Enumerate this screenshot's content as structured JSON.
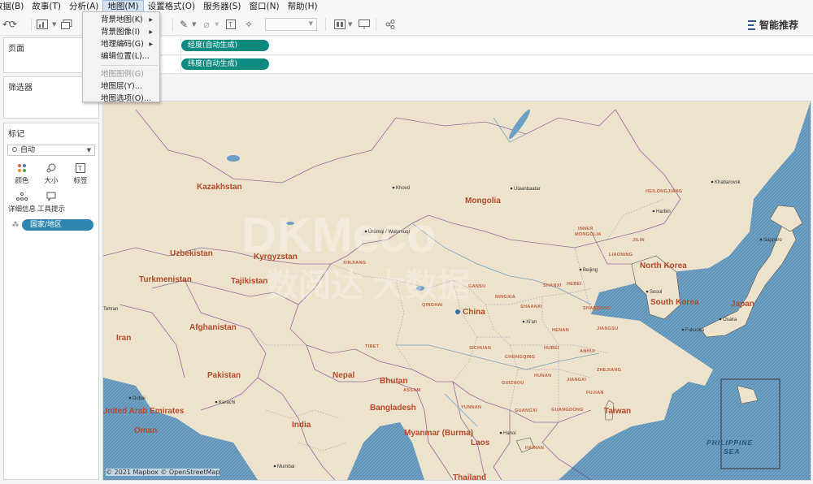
{
  "menu": [
    "数据(B)",
    "故事(T)",
    "分析(A)",
    "地图(M)",
    "设置格式(O)",
    "服务器(S)",
    "窗口(N)",
    "帮助(H)"
  ],
  "toolbar": {
    "smart_label": "智能推荐"
  },
  "map_menu": {
    "items": [
      {
        "label": "背景地图(K)",
        "submenu": true,
        "disabled": false
      },
      {
        "label": "背景图像(I)",
        "submenu": true,
        "disabled": false
      },
      {
        "label": "地理编码(G)",
        "submenu": true,
        "disabled": false
      },
      {
        "label": "编辑位置(L)...",
        "submenu": false,
        "disabled": false
      },
      {
        "label": "地图图例(G)",
        "submenu": false,
        "disabled": true
      },
      {
        "label": "地图层(Y)...",
        "submenu": false,
        "disabled": false
      },
      {
        "label": "地图选项(O)...",
        "submenu": false,
        "disabled": false
      }
    ]
  },
  "panels": {
    "pages": "页面",
    "filters": "筛选器",
    "marks": "标记"
  },
  "marks": {
    "type": "自动",
    "buttons": {
      "color": "颜色",
      "size": "大小",
      "label": "标签",
      "detail": "详细信息",
      "tooltip": "工具提示"
    },
    "pill": "国家/地区"
  },
  "shelves": {
    "columns_pill": "经度(自动生成)",
    "rows_pill": "纬度(自动生成)"
  },
  "map": {
    "attribution": "© 2021 Mapbox © OpenStreetMap",
    "countries": [
      "Kazakhstan",
      "Mongolia",
      "Uzbekistan",
      "Kyrgyzstan",
      "Turkmenistan",
      "Tajikistan",
      "Afghanistan",
      "Iran",
      "Pakistan",
      "Nepal",
      "Bhutan",
      "Bangladesh",
      "India",
      "Myanmar (Burma)",
      "Laos",
      "Thailand",
      "China",
      "North Korea",
      "South Korea",
      "Japan",
      "Taiwan",
      "Oman",
      "United Arab Emirates"
    ],
    "seas": [
      "PHILIPPINE",
      "SEA"
    ],
    "regions": [
      "HEILONGJIANG",
      "JILIN",
      "LIAONING",
      "INNER",
      "MONGOLIA",
      "XINJIANG",
      "QINGHAI",
      "GANSU",
      "NINGXIA",
      "SHANXI",
      "HEBEI",
      "SHAANXI",
      "SHANDONG",
      "HENAN",
      "JIANGSU",
      "ANHUI",
      "HUBEI",
      "SICHUAN",
      "TIBET",
      "CHONGQING",
      "HUNAN",
      "JIANGXI",
      "ZHEJIANG",
      "GUIZHOU",
      "FUJIAN",
      "YUNNAN",
      "GUANGXI",
      "GUANGDONG",
      "HAINAN",
      "ASSAM"
    ],
    "cities": [
      "Khovd",
      "Ulaanbaatar",
      "Ürümqi / Wulumuqi",
      "Harbin",
      "Khabarovsk",
      "Sapporo",
      "Beijing",
      "Seoul",
      "Osaka",
      "Fukuoka",
      "Xi'an",
      "Tehran",
      "Karachi",
      "Dubai",
      "Hanoi",
      "Mumbai"
    ]
  },
  "watermark": {
    "line1": "DKMeco",
    "line2": "数阅达  大数据"
  }
}
